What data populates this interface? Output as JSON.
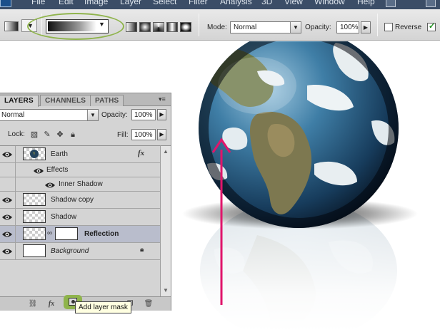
{
  "menu": {
    "items": [
      "File",
      "Edit",
      "Image",
      "Layer",
      "Select",
      "Filter",
      "Analysis",
      "3D",
      "View",
      "Window",
      "Help"
    ]
  },
  "options_bar": {
    "mode_label": "Mode:",
    "mode_value": "Normal",
    "opacity_label": "Opacity:",
    "opacity_value": "100%",
    "reverse_label": "Reverse",
    "reverse_checked": false,
    "dither_checked": true,
    "gradient_types": [
      "linear-gradient-icon",
      "radial-gradient-icon",
      "angle-gradient-icon",
      "reflected-gradient-icon",
      "diamond-gradient-icon"
    ]
  },
  "layers_panel": {
    "tabs": [
      "LAYERS",
      "CHANNELS",
      "PATHS"
    ],
    "blend_mode": "Normal",
    "opacity_label": "Opacity:",
    "opacity_value": "100%",
    "lock_label": "Lock:",
    "fill_label": "Fill:",
    "fill_value": "100%",
    "layers": [
      {
        "name": "Earth",
        "fx": "fx"
      },
      {
        "name": "Effects"
      },
      {
        "name": "Inner Shadow"
      },
      {
        "name": "Shadow copy"
      },
      {
        "name": "Shadow"
      },
      {
        "name": "Reflection",
        "selected": true
      },
      {
        "name": "Background"
      }
    ],
    "footer_fx": "fx",
    "tooltip": "Add layer mask"
  },
  "colors": {
    "annotation_green": "#8fb44c",
    "arrow_magenta": "#e0156b",
    "selected_row": "#b9bdcc"
  }
}
